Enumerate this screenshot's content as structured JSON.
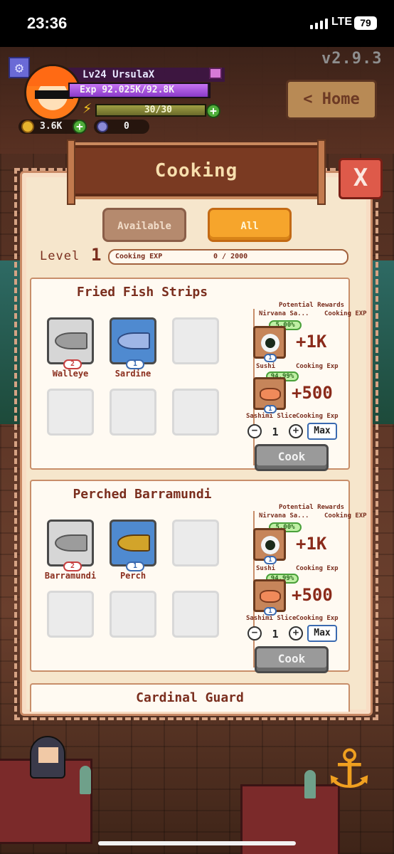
{
  "status_bar": {
    "time": "23:36",
    "network": "LTE",
    "battery": "79"
  },
  "hud": {
    "version": "v2.9.3",
    "home_button": "< Home",
    "player": {
      "name": "Lv24 UrsulaX",
      "exp_text": "Exp  92.025K/92.8K",
      "exp_fraction": 0.99,
      "energy_text": "30/30",
      "energy_fraction": 1.0,
      "coins": "3.6K",
      "gems": "0"
    }
  },
  "modal": {
    "title": "Cooking",
    "close_label": "X",
    "tabs": {
      "available": "Available",
      "all": "All"
    },
    "level_label": "Level",
    "level_value": "1",
    "exp_label": "Cooking EXP",
    "exp_value": "0 / 2000",
    "rewards_title": "Potential Rewards",
    "rewards_col_a": "Nirvana Sa...",
    "rewards_col_b": "Cooking EXP",
    "recipes": [
      {
        "name": "Fried Fish Strips",
        "ingredients": [
          {
            "name": "Walleye",
            "qty": "2"
          },
          {
            "name": "Sardine",
            "qty": "1"
          }
        ],
        "rewards": [
          {
            "chance": "5.00%",
            "count": "1",
            "amount": "+1K",
            "item": "Sushi",
            "exp_label": "Cooking Exp"
          },
          {
            "chance": "94.99%",
            "count": "1",
            "amount": "+500",
            "item": "Sashimi Slice",
            "exp_label": "Cooking Exp"
          }
        ],
        "quantity": "1",
        "max_label": "Max",
        "cook_label": "Cook"
      },
      {
        "name": "Perched Barramundi",
        "ingredients": [
          {
            "name": "Barramundi",
            "qty": "2"
          },
          {
            "name": "Perch",
            "qty": "1"
          }
        ],
        "rewards": [
          {
            "chance": "5.00%",
            "count": "1",
            "amount": "+1K",
            "item": "Sushi",
            "exp_label": "Cooking Exp"
          },
          {
            "chance": "94.99%",
            "count": "1",
            "amount": "+500",
            "item": "Sashimi Slice",
            "exp_label": "Cooking Exp"
          }
        ],
        "quantity": "1",
        "max_label": "Max",
        "cook_label": "Cook"
      },
      {
        "name": "Cardinal Guard"
      }
    ]
  },
  "icons": [
    "gear-icon",
    "mail-icon",
    "energy-icon",
    "coin-icon",
    "gem-icon",
    "plus-icon",
    "anchor-icon"
  ],
  "colors": {
    "modal_bg": "#f6e6cc",
    "tab_active": "#f6a52c",
    "close": "#de5a4a",
    "title_board": "#7a3a22"
  }
}
